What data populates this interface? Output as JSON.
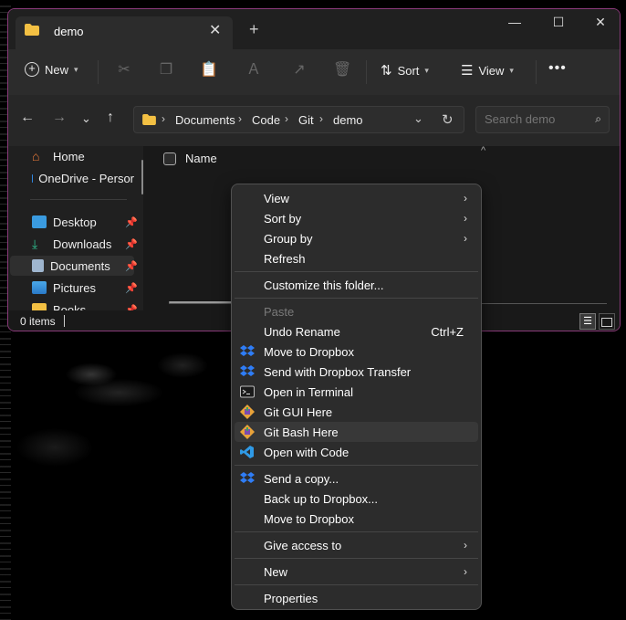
{
  "tab": {
    "title": "demo"
  },
  "toolbar": {
    "new_label": "New",
    "sort_label": "Sort",
    "view_label": "View"
  },
  "address": {
    "crumbs": [
      "Documents",
      "Code",
      "Git",
      "demo"
    ]
  },
  "search": {
    "placeholder": "Search demo"
  },
  "sidebar": {
    "items": [
      {
        "label": "Home",
        "icon": "home-icon"
      },
      {
        "label": "OneDrive - Persor",
        "icon": "onedrive-icon"
      },
      {
        "label": "Desktop",
        "icon": "desktop-icon",
        "pinned": true
      },
      {
        "label": "Downloads",
        "icon": "download-icon",
        "pinned": true
      },
      {
        "label": "Documents",
        "icon": "documents-icon",
        "pinned": true,
        "active": true
      },
      {
        "label": "Pictures",
        "icon": "pictures-icon",
        "pinned": true
      },
      {
        "label": "Books",
        "icon": "folder-icon",
        "pinned": true
      }
    ]
  },
  "list": {
    "header_name": "Name"
  },
  "status": {
    "items_count": "0 items"
  },
  "context_menu": {
    "items": [
      {
        "label": "View",
        "submenu": true
      },
      {
        "label": "Sort by",
        "submenu": true
      },
      {
        "label": "Group by",
        "submenu": true
      },
      {
        "label": "Refresh"
      },
      {
        "label": "Customize this folder..."
      },
      {
        "label": "Paste",
        "disabled": true
      },
      {
        "label": "Undo Rename",
        "shortcut": "Ctrl+Z"
      },
      {
        "label": "Move to Dropbox",
        "icon": "dropbox-icon"
      },
      {
        "label": "Send with Dropbox Transfer",
        "icon": "dropbox-icon"
      },
      {
        "label": "Open in Terminal",
        "icon": "terminal-icon"
      },
      {
        "label": "Git GUI Here",
        "icon": "git-icon"
      },
      {
        "label": "Git Bash Here",
        "icon": "git-icon",
        "hover": true
      },
      {
        "label": "Open with Code",
        "icon": "vscode-icon"
      },
      {
        "label": "Send a copy...",
        "icon": "dropbox-icon"
      },
      {
        "label": "Back up to Dropbox..."
      },
      {
        "label": "Move to Dropbox"
      },
      {
        "label": "Give access to",
        "submenu": true
      },
      {
        "label": "New",
        "submenu": true
      },
      {
        "label": "Properties"
      }
    ]
  },
  "colors": {
    "window_border": "#8a3a7a",
    "folder": "#f3c043",
    "dropbox": "#0061fe",
    "vscode": "#2f9ae6",
    "git": "#e8a23a"
  }
}
